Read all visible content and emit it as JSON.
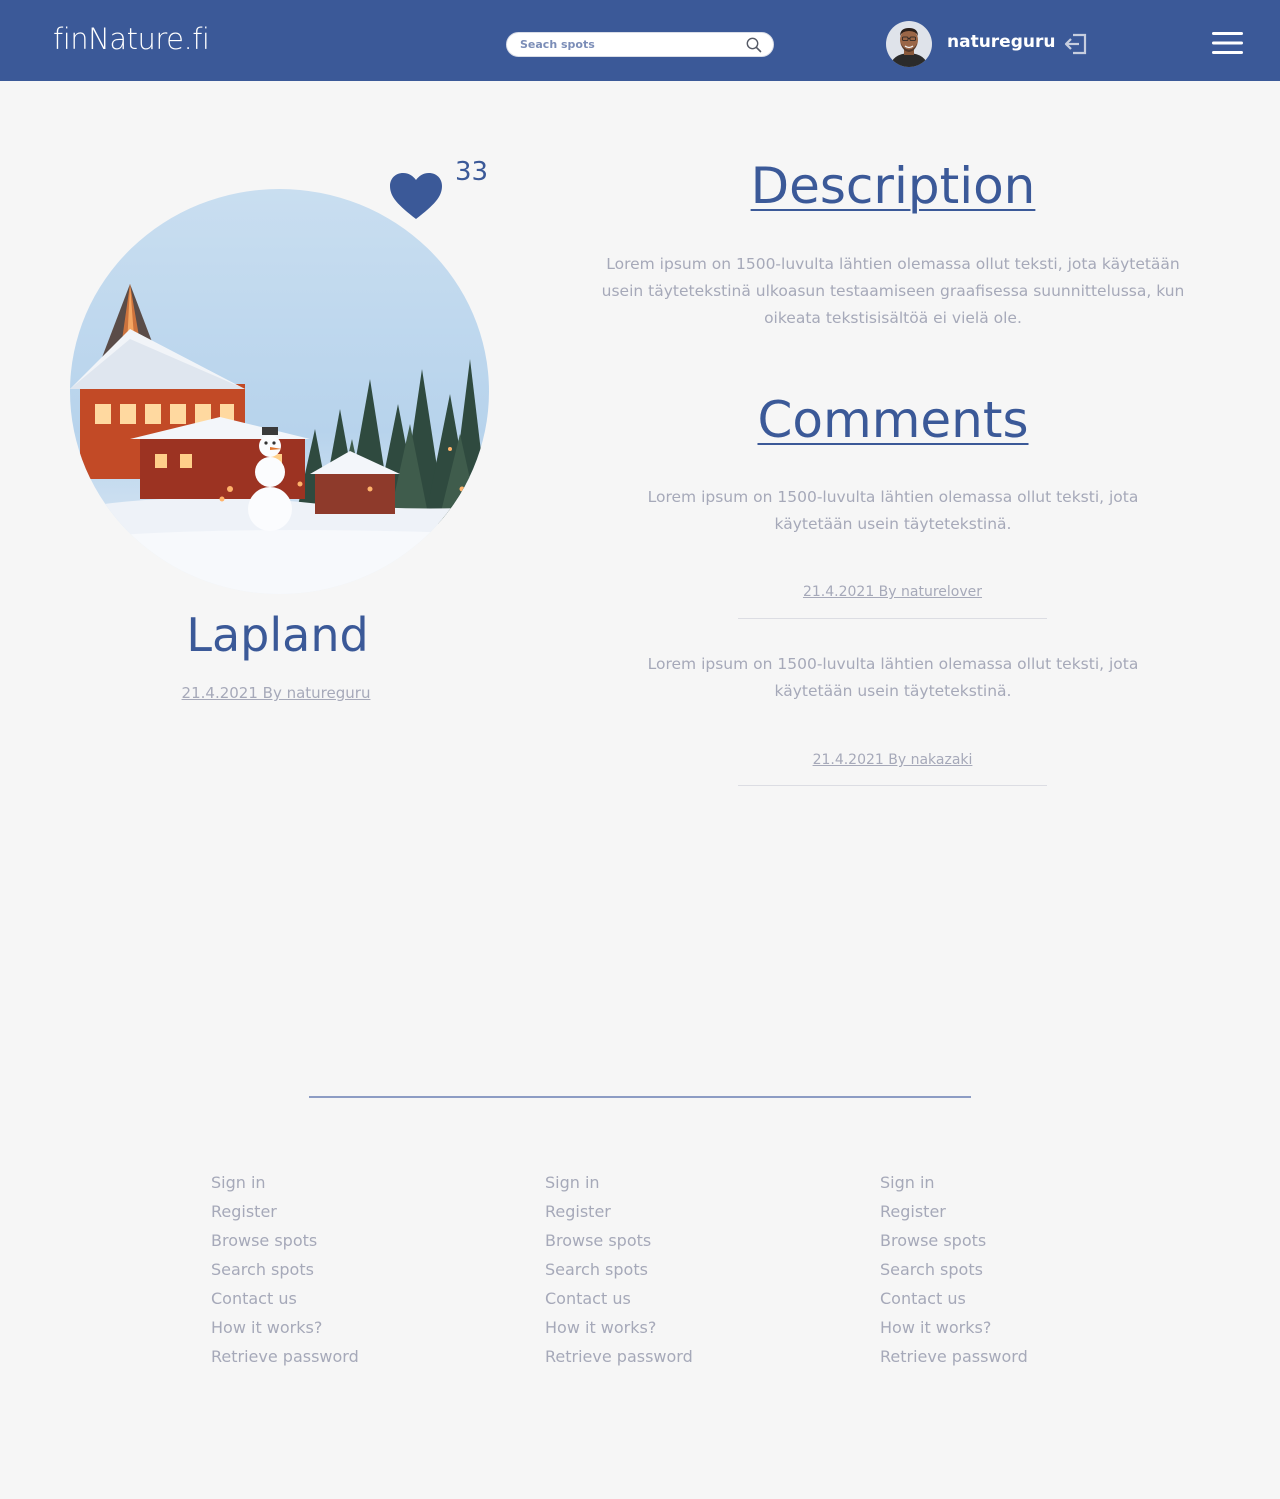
{
  "header": {
    "logo": "finNature.fi",
    "search_placeholder": "Seach spots",
    "username": "natureguru"
  },
  "spot": {
    "title": "Lapland",
    "likes": "33",
    "meta": "21.4.2021 By natureguru"
  },
  "description": {
    "heading": "Description",
    "text": "Lorem ipsum on 1500-luvulta lähtien olemassa ollut teksti, jota käytetään usein täytetekstinä ulkoasun testaamiseen graafisessa suunnittelussa, kun oikeata tekstisisältöä ei vielä ole."
  },
  "comments": {
    "heading": "Comments",
    "items": [
      {
        "text": "Lorem ipsum on 1500-luvulta lähtien olemassa ollut teksti, jota käytetään usein täytetekstinä.",
        "meta": "21.4.2021 By naturelover"
      },
      {
        "text": "Lorem ipsum on 1500-luvulta lähtien olemassa ollut teksti, jota käytetään usein täytetekstinä.",
        "meta": "21.4.2021 By nakazaki"
      }
    ]
  },
  "footer": {
    "columns": [
      [
        "Sign in",
        "Register",
        "Browse spots",
        "Search spots",
        "Contact us",
        "How it works?",
        "Retrieve password"
      ],
      [
        "Sign in",
        "Register",
        "Browse spots",
        "Search spots",
        "Contact us",
        "How it works?",
        "Retrieve password"
      ],
      [
        "Sign in",
        "Register",
        "Browse spots",
        "Search spots",
        "Contact us",
        "How it works?",
        "Retrieve password"
      ]
    ]
  },
  "icons": {
    "search": "search-icon",
    "logout": "logout-icon",
    "menu": "hamburger-menu-icon",
    "like": "heart-icon"
  },
  "colors": {
    "brand": "#3b5998",
    "muted_text": "#a6a9b9",
    "background": "#f6f6f6"
  }
}
